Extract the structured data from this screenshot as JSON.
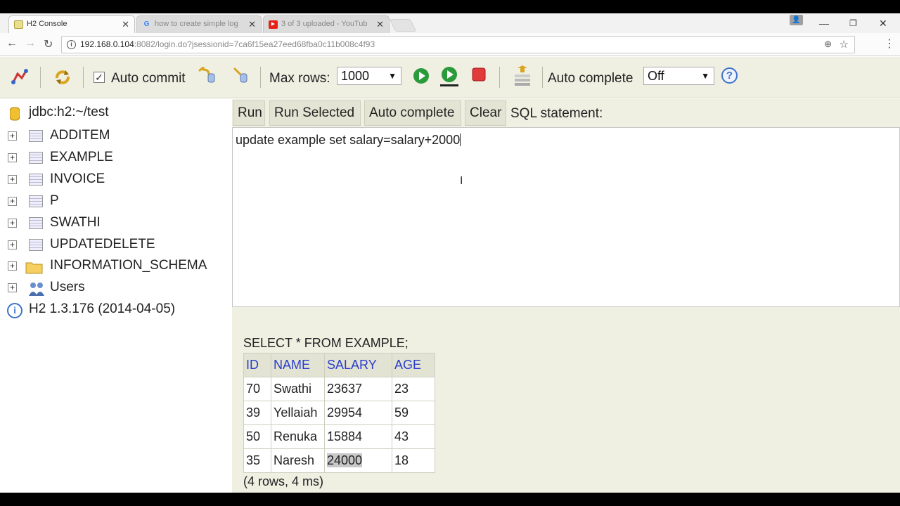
{
  "browser": {
    "tabs": [
      {
        "title": "H2 Console",
        "active": true
      },
      {
        "title": "how to create simple log",
        "active": false
      },
      {
        "title": "3 of 3 uploaded - YouTub",
        "active": false
      }
    ],
    "url_host": "192.168.0.104",
    "url_rest": ":8082/login.do?jsessionid=7ca6f15ea27eed68fba0c11b008c4f93"
  },
  "toolbar": {
    "auto_commit_label": "Auto commit",
    "max_rows_label": "Max rows:",
    "max_rows_value": "1000",
    "auto_complete_label": "Auto complete",
    "auto_complete_value": "Off",
    "help_label": "?"
  },
  "tree": {
    "connection": "jdbc:h2:~/test",
    "tables": [
      "ADDITEM",
      "EXAMPLE",
      "INVOICE",
      "P",
      "SWATHI",
      "UPDATEDELETE"
    ],
    "schema": "INFORMATION_SCHEMA",
    "users": "Users",
    "version": "H2 1.3.176 (2014-04-05)"
  },
  "sql": {
    "run": "Run",
    "run_selected": "Run Selected",
    "auto_complete": "Auto complete",
    "clear": "Clear",
    "statement_label": "SQL statement:",
    "editor_text": "update example set salary=salary+2000"
  },
  "result": {
    "query": "SELECT * FROM EXAMPLE;",
    "columns": [
      "ID",
      "NAME",
      "SALARY",
      "AGE"
    ],
    "rows": [
      [
        "70",
        "Swathi",
        "23637",
        "23"
      ],
      [
        "39",
        "Yellaiah",
        "29954",
        "59"
      ],
      [
        "50",
        "Renuka",
        "15884",
        "43"
      ],
      [
        "35",
        "Naresh",
        "24000",
        "18"
      ]
    ],
    "footer": "(4 rows, 4 ms)"
  }
}
